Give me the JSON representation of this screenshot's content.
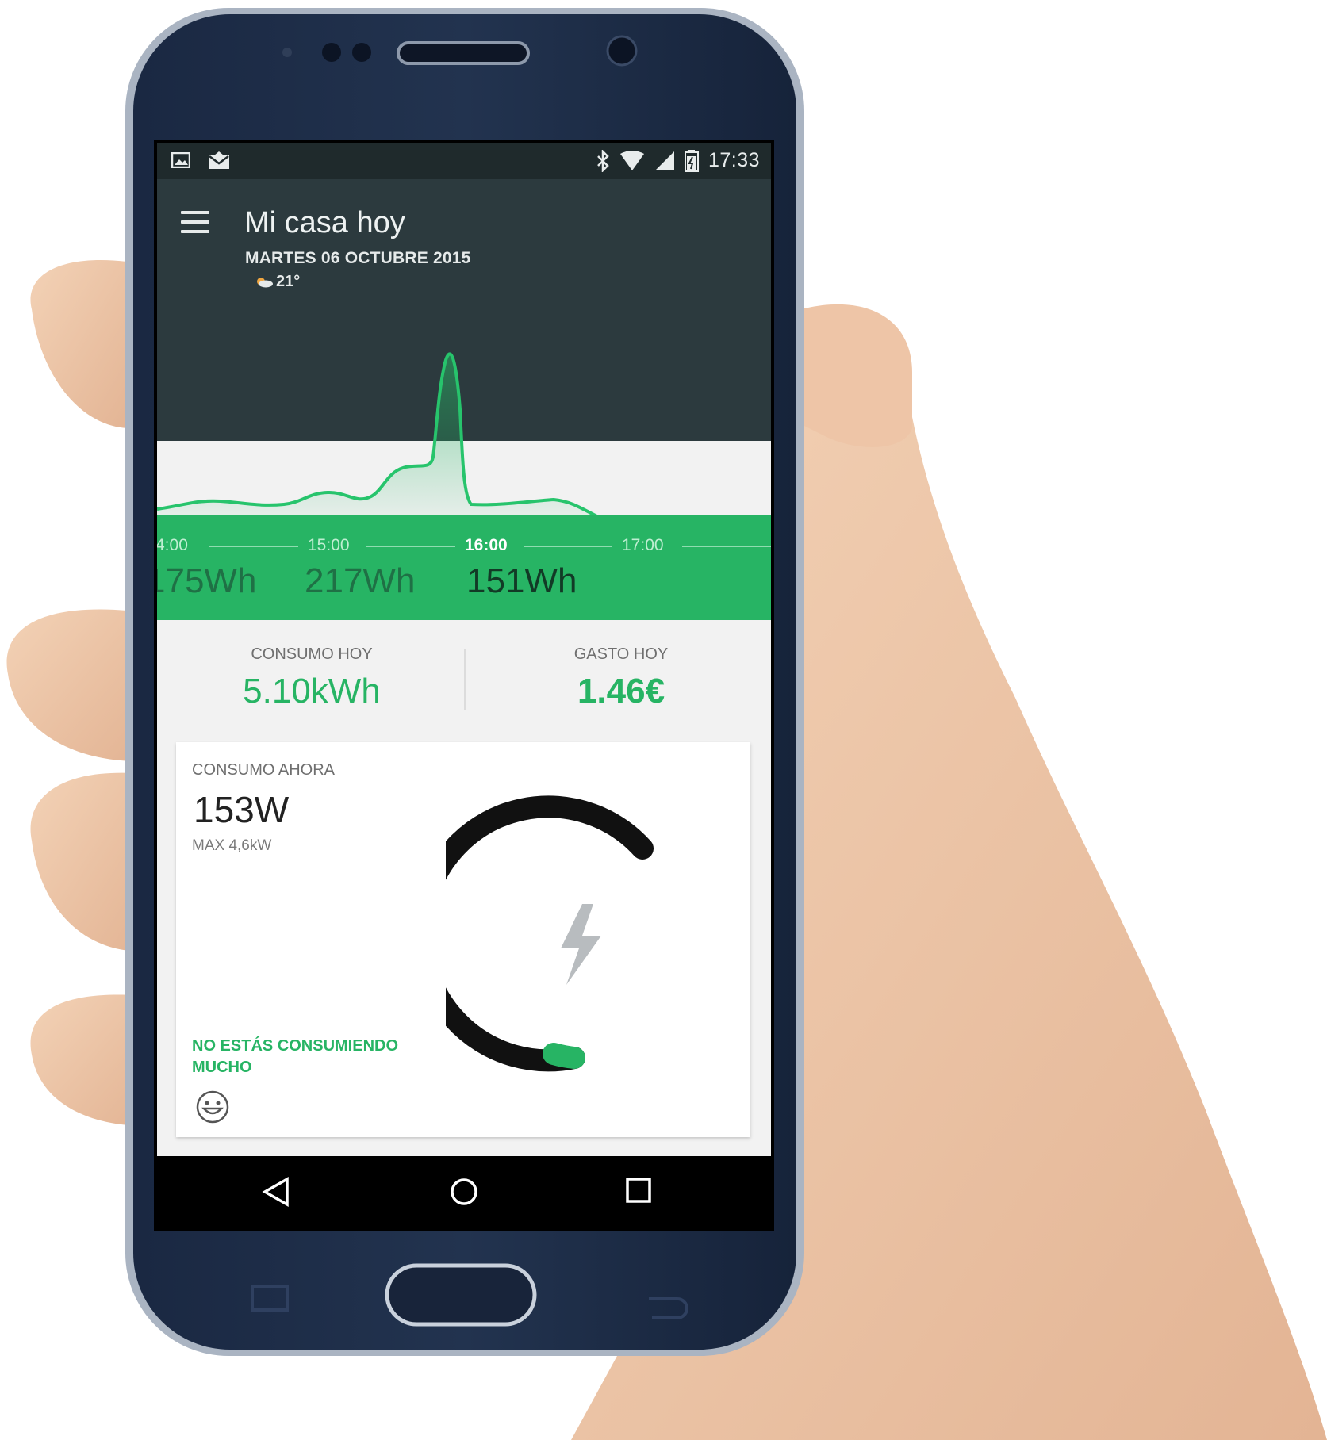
{
  "status_bar": {
    "time": "17:33",
    "left_icons": [
      "image-icon",
      "mail-icon"
    ],
    "right_icons": [
      "bluetooth-icon",
      "wifi-icon",
      "signal-icon",
      "battery-icon"
    ]
  },
  "app_bar": {
    "title": "Mi casa hoy",
    "date": "MARTES 06 OCTUBRE 2015",
    "weather": {
      "icon": "partly-cloudy-icon",
      "temperature": "21°"
    },
    "menu_icon": "hamburger-menu-icon"
  },
  "timeline": {
    "ticks": [
      {
        "label": "4:00",
        "active": false
      },
      {
        "label": "15:00",
        "active": false
      },
      {
        "label": "16:00",
        "active": true
      },
      {
        "label": "17:00",
        "active": false
      }
    ],
    "readings": [
      {
        "label": "175Wh",
        "active": false
      },
      {
        "label": "217Wh",
        "active": false
      },
      {
        "label": "151Wh",
        "active": true
      }
    ]
  },
  "summary": {
    "consumo_label": "CONSUMO HOY",
    "consumo_value": "5.10kWh",
    "gasto_label": "GASTO HOY",
    "gasto_value": "1.46€"
  },
  "card": {
    "label": "CONSUMO AHORA",
    "value": "153W",
    "max": "MAX 4,6kW",
    "message": "NO ESTÁS CONSUMIENDO MUCHO",
    "mood_icon": "smiley-icon",
    "gauge_icon": "lightning-icon",
    "gauge_fraction": 0.033
  },
  "navigation": {
    "back_icon": "back-triangle-icon",
    "home_icon": "home-circle-icon",
    "recents_icon": "recents-square-icon"
  },
  "colors": {
    "accent_green": "#27b464",
    "appbar_dark": "#2c3a3e",
    "statusbar_dark": "#1f2a2c",
    "phone_body": "#1b2a45"
  }
}
